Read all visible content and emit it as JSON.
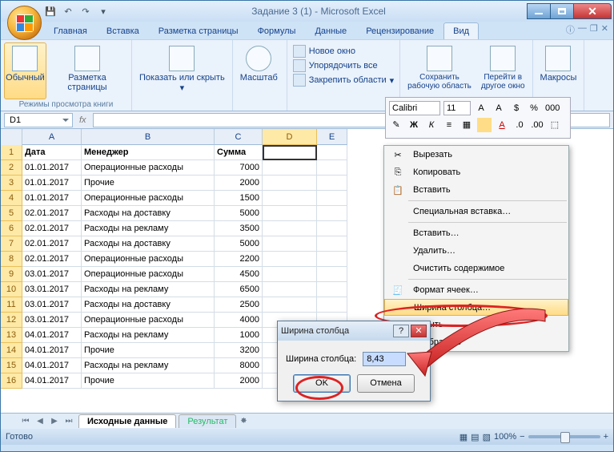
{
  "title": "Задание 3 (1) - Microsoft Excel",
  "tabs": [
    "Главная",
    "Вставка",
    "Разметка страницы",
    "Формулы",
    "Данные",
    "Рецензирование",
    "Вид"
  ],
  "active_tab": 6,
  "ribbon": {
    "modes_label": "Режимы просмотра книги",
    "normal": "Обычный",
    "layout": "Разметка страницы",
    "show_hide": "Показать или скрыть",
    "zoom": "Масштаб",
    "new_window": "Новое окно",
    "arrange": "Упорядочить все",
    "freeze": "Закрепить области",
    "save_ws": "Сохранить\nрабочую область",
    "goto_win": "Перейти в\nдругое окно",
    "macros": "Макросы"
  },
  "namebox": "D1",
  "cols": [
    "A",
    "B",
    "C",
    "D",
    "E"
  ],
  "headers": [
    "Дата",
    "Менеджер",
    "Сумма"
  ],
  "rows": [
    [
      "01.01.2017",
      "Операционные расходы",
      "7000"
    ],
    [
      "01.01.2017",
      "Прочие",
      "2000"
    ],
    [
      "01.01.2017",
      "Операционные расходы",
      "1500"
    ],
    [
      "02.01.2017",
      "Расходы на доставку",
      "5000"
    ],
    [
      "02.01.2017",
      "Расходы на рекламу",
      "3500"
    ],
    [
      "02.01.2017",
      "Расходы на доставку",
      "5000"
    ],
    [
      "02.01.2017",
      "Операционные расходы",
      "2200"
    ],
    [
      "03.01.2017",
      "Операционные расходы",
      "4500"
    ],
    [
      "03.01.2017",
      "Расходы на рекламу",
      "6500"
    ],
    [
      "03.01.2017",
      "Расходы на доставку",
      "2500"
    ],
    [
      "03.01.2017",
      "Операционные расходы",
      "4000"
    ],
    [
      "04.01.2017",
      "Расходы на рекламу",
      "1000"
    ],
    [
      "04.01.2017",
      "Прочие",
      "3200"
    ],
    [
      "04.01.2017",
      "Расходы на рекламу",
      "8000"
    ],
    [
      "04.01.2017",
      "Прочие",
      "2000"
    ]
  ],
  "sheet_tabs": [
    "Исходные данные",
    "Результат"
  ],
  "status": "Готово",
  "zoom_pct": "100%",
  "mini": {
    "font": "Calibri",
    "size": "11"
  },
  "ctx": {
    "cut": "Вырезать",
    "copy": "Копировать",
    "paste": "Вставить",
    "paste_special": "Специальная вставка…",
    "insert": "Вставить…",
    "delete": "Удалить…",
    "clear": "Очистить содержимое",
    "format": "Формат ячеек…",
    "col_width": "Ширина столбца…",
    "hide": "Скрыть",
    "unhide": "Отобразить"
  },
  "dialog": {
    "title": "Ширина столбца",
    "label": "Ширина столбца:",
    "value": "8,43",
    "ok": "OK",
    "cancel": "Отмена"
  }
}
